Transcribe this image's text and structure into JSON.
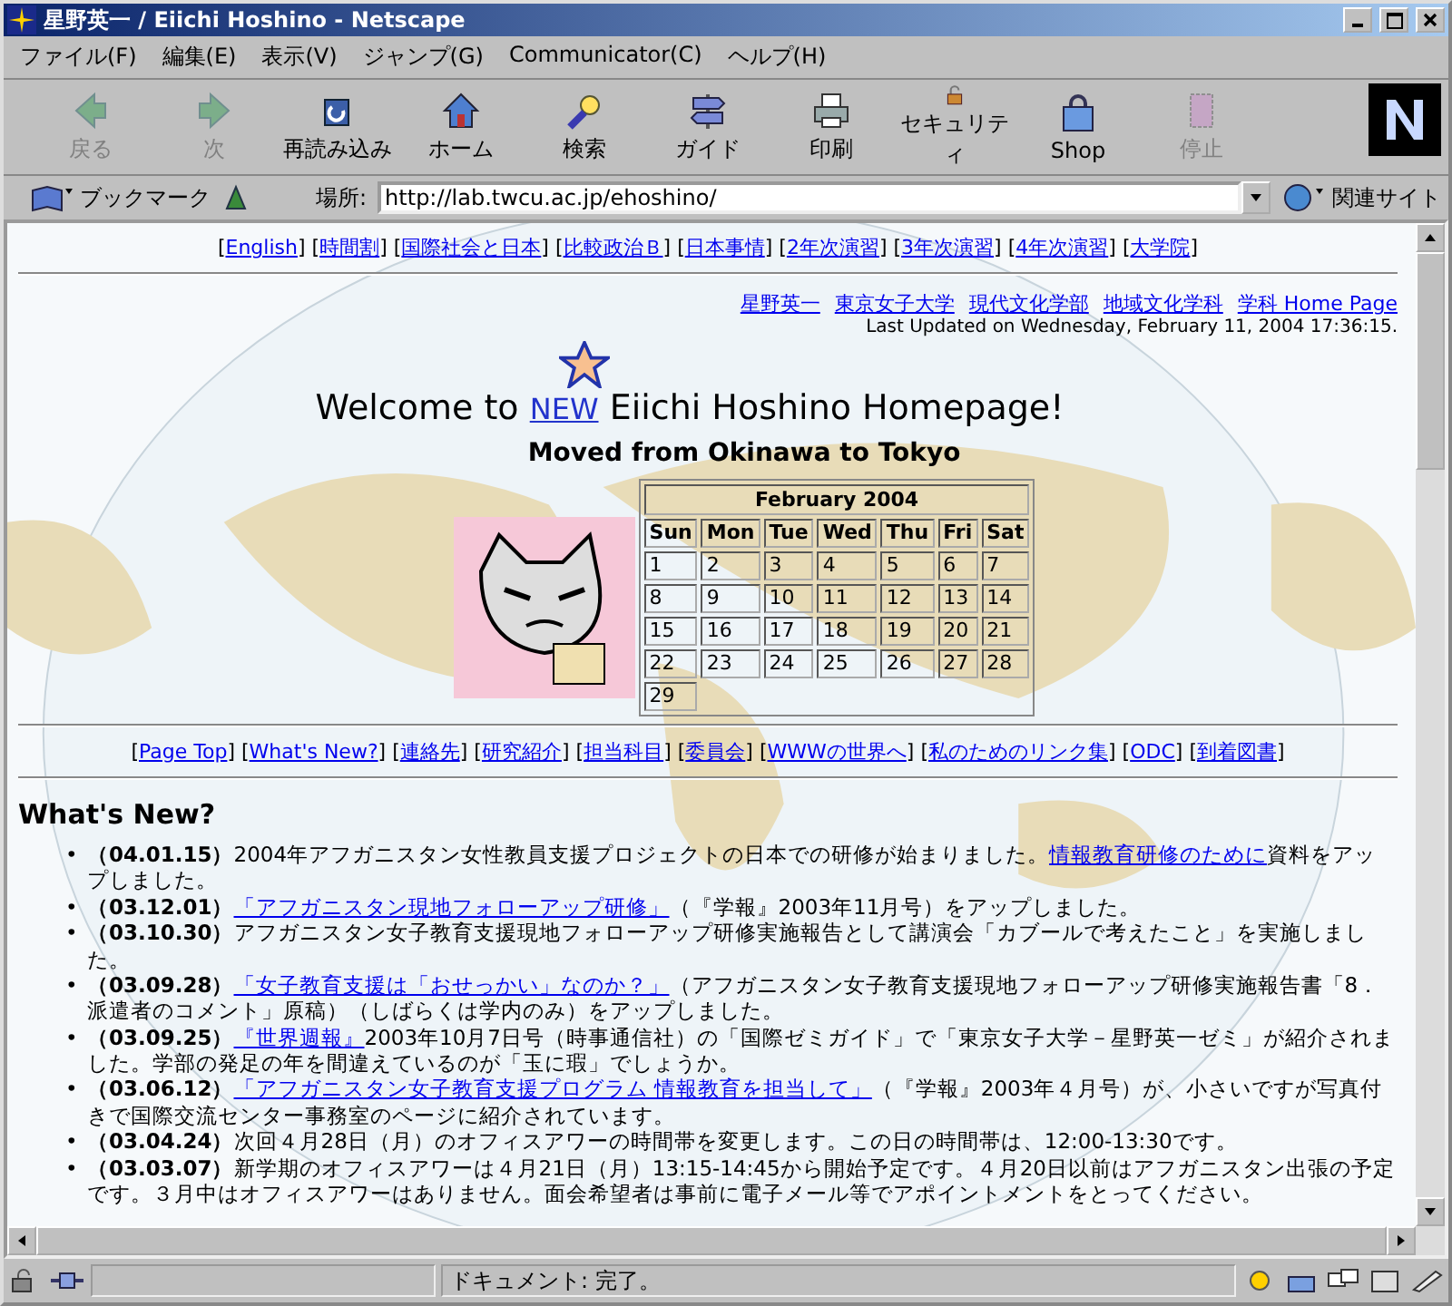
{
  "window": {
    "title": "星野英一 / Eiichi Hoshino - Netscape"
  },
  "menu": [
    "ファイル(F)",
    "編集(E)",
    "表示(V)",
    "ジャンプ(G)",
    "Communicator(C)",
    "ヘルプ(H)"
  ],
  "toolbar": [
    {
      "label": "戻る",
      "disabled": true
    },
    {
      "label": "次",
      "disabled": true
    },
    {
      "label": "再読み込み",
      "disabled": false
    },
    {
      "label": "ホーム",
      "disabled": false
    },
    {
      "label": "検索",
      "disabled": false
    },
    {
      "label": "ガイド",
      "disabled": false
    },
    {
      "label": "印刷",
      "disabled": false
    },
    {
      "label": "セキュリティ",
      "disabled": false
    },
    {
      "label": "Shop",
      "disabled": false
    },
    {
      "label": "停止",
      "disabled": true
    }
  ],
  "location_bar": {
    "bookmarks": "ブックマーク",
    "label": "場所:",
    "url": "http://lab.twcu.ac.jp/ehoshino/",
    "related": "関連サイト"
  },
  "page": {
    "top_nav": [
      {
        "open": "[",
        "text": "English",
        "close": "]"
      },
      {
        "open": "[",
        "text": "時間割",
        "close": "]"
      },
      {
        "open": "[",
        "text": "国際社会と日本",
        "close": "]"
      },
      {
        "open": "[",
        "text": "比較政治Ｂ",
        "close": "]"
      },
      {
        "open": "[",
        "text": "日本事情",
        "close": "]"
      },
      {
        "open": "[",
        "text": "2年次演習",
        "close": "]"
      },
      {
        "open": "[",
        "text": "3年次演習",
        "close": "]"
      },
      {
        "open": "[",
        "text": "4年次演習",
        "close": "]"
      },
      {
        "open": "[",
        "text": "大学院",
        "close": "]"
      }
    ],
    "header_links": [
      "星野英一",
      "東京女子大学",
      "現代文化学部",
      "地域文化学科",
      "学科 Home Page"
    ],
    "last_updated": "Last Updated on Wednesday, February 11, 2004 17:36:15.",
    "welcome": {
      "before": "Welcome to",
      "new": "NEW",
      "after": "Eiichi Hoshino Homepage!"
    },
    "subtitle": "Moved from Okinawa to Tokyo",
    "calendar": {
      "title": "February 2004",
      "weekdays": [
        "Sun",
        "Mon",
        "Tue",
        "Wed",
        "Thu",
        "Fri",
        "Sat"
      ],
      "weeks": [
        [
          "1",
          "2",
          "3",
          "4",
          "5",
          "6",
          "7"
        ],
        [
          "8",
          "9",
          "10",
          "11",
          "12",
          "13",
          "14"
        ],
        [
          "15",
          "16",
          "17",
          "18",
          "19",
          "20",
          "21"
        ],
        [
          "22",
          "23",
          "24",
          "25",
          "26",
          "27",
          "28"
        ],
        [
          "29"
        ]
      ]
    },
    "bottom_nav": [
      {
        "open": "[",
        "text": "Page Top",
        "close": "]"
      },
      {
        "open": "[",
        "text": "What's New?",
        "close": "]"
      },
      {
        "open": "[",
        "text": "連絡先",
        "close": "]"
      },
      {
        "open": "[",
        "text": "研究紹介",
        "close": "]"
      },
      {
        "open": "[",
        "text": "担当科目",
        "close": "]"
      },
      {
        "open": "[",
        "text": "委員会",
        "close": "]"
      },
      {
        "open": "[",
        "text": "WWWの世界へ",
        "close": "]"
      },
      {
        "open": "[",
        "text": "私のためのリンク集",
        "close": "]"
      },
      {
        "open": "[",
        "text": "ODC",
        "close": "]"
      },
      {
        "open": "[",
        "text": "到着図書",
        "close": "]"
      }
    ],
    "whats_new_heading": "What's New?",
    "news": [
      {
        "bullet": "•",
        "date": "（04.01.15）",
        "parts": [
          {
            "kind": "text",
            "text": "2004年アフガニスタン女性教員支援プロジェクトの日本での研修が始まりました。"
          },
          {
            "kind": "link",
            "text": "情報教育研修のために"
          },
          {
            "kind": "text",
            "text": "資料をアップしました。"
          }
        ]
      },
      {
        "bullet": "•",
        "date": "（03.12.01）",
        "parts": [
          {
            "kind": "link",
            "text": "「アフガニスタン現地フォローアップ研修」"
          },
          {
            "kind": "text",
            "text": "（『学報』2003年11月号）をアップしました。"
          }
        ]
      },
      {
        "bullet": "•",
        "date": "（03.10.30）",
        "parts": [
          {
            "kind": "text",
            "text": "アフガニスタン女子教育支援現地フォローアップ研修実施報告として講演会「カブールで考えたこと」を実施しました。"
          }
        ]
      },
      {
        "bullet": "•",
        "date": "（03.09.28）",
        "parts": [
          {
            "kind": "link",
            "text": "「女子教育支援は「おせっかい」なのか？」"
          },
          {
            "kind": "text",
            "text": "（アフガニスタン女子教育支援現地フォローアップ研修実施報告書「8．派遣者のコメント」原稿）（しばらくは学内のみ）をアップしました。"
          }
        ]
      },
      {
        "bullet": "•",
        "date": "（03.09.25）",
        "parts": [
          {
            "kind": "link",
            "text": "『世界週報』"
          },
          {
            "kind": "text",
            "text": "2003年10月7日号（時事通信社）の「国際ゼミガイド」で「東京女子大学－星野英一ゼミ」が紹介されました。学部の発足の年を間違えているのが「玉に瑕」でしょうか。"
          }
        ]
      },
      {
        "bullet": "•",
        "date": "（03.06.12）",
        "parts": [
          {
            "kind": "link",
            "text": "「アフガニスタン女子教育支援プログラム 情報教育を担当して」"
          },
          {
            "kind": "text",
            "text": "（『学報』2003年４月号）が、小さいですが写真付きで国際交流センター事務室のページに紹介されています。"
          }
        ]
      },
      {
        "bullet": "•",
        "date": "（03.04.24）",
        "parts": [
          {
            "kind": "text",
            "text": "次回４月28日（月）のオフィスアワーの時間帯を変更します。この日の時間帯は、12:00-13:30です。"
          }
        ]
      },
      {
        "bullet": "•",
        "date": "（03.03.07）",
        "parts": [
          {
            "kind": "text",
            "text": "新学期のオフィスアワーは４月21日（月）13:15-14:45から開始予定です。４月20日以前はアフガニスタン出張の予定です。３月中はオフィスアワーはありません。面会希望者は事前に電子メール等でアポイントメントをとってください。"
          }
        ]
      }
    ]
  },
  "status_bar": {
    "text": "ドキュメント: 完了。"
  }
}
